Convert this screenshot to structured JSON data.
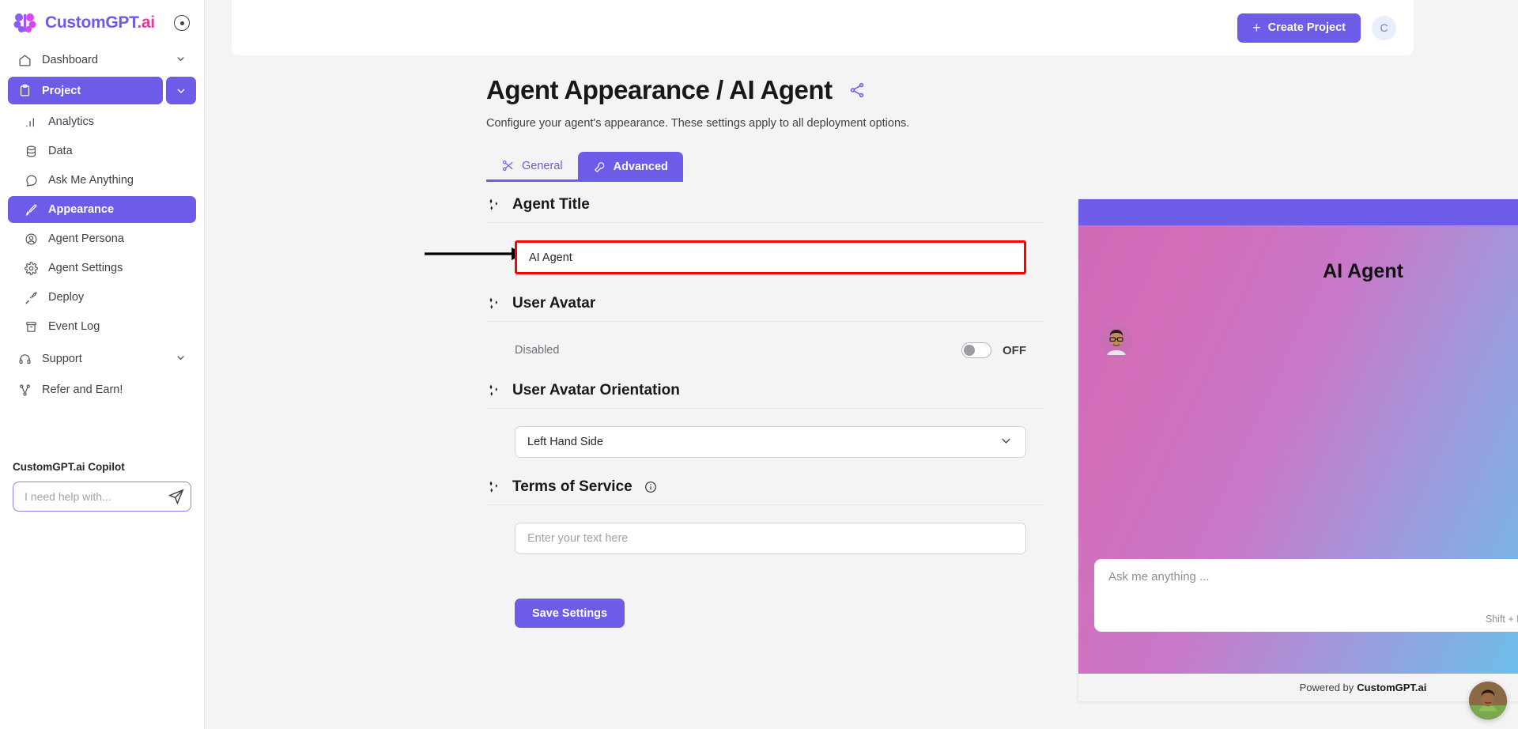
{
  "brand": {
    "name_part1": "CustomGPT",
    "name_part2": ".ai"
  },
  "sidebar": {
    "dashboard": {
      "label": "Dashboard",
      "icon": "home-icon"
    },
    "project": {
      "label": "Project",
      "icon": "clipboard-icon"
    },
    "sub_items": [
      {
        "label": "Analytics",
        "icon": "bar-chart-icon"
      },
      {
        "label": "Data",
        "icon": "database-icon"
      },
      {
        "label": "Ask Me Anything",
        "icon": "chat-bubble-icon"
      },
      {
        "label": "Appearance",
        "icon": "brush-icon"
      },
      {
        "label": "Agent Persona",
        "icon": "user-circle-icon"
      },
      {
        "label": "Agent Settings",
        "icon": "gear-icon"
      },
      {
        "label": "Deploy",
        "icon": "rocket-icon"
      },
      {
        "label": "Event Log",
        "icon": "archive-icon"
      }
    ],
    "support": {
      "label": "Support",
      "icon": "headset-icon"
    },
    "refer": {
      "label": "Refer and Earn!",
      "icon": "share-nodes-icon"
    },
    "copilot": {
      "title": "CustomGPT.ai Copilot",
      "placeholder": "I need help with...",
      "value": ""
    }
  },
  "topbar": {
    "create_project_label": "Create Project",
    "plus": "+",
    "avatar_initial": "C"
  },
  "page": {
    "title": "Agent Appearance / AI Agent",
    "subtitle": "Configure your agent's appearance. These settings apply to all deployment options.",
    "tabs": [
      {
        "label": "General",
        "icon": "scissors-icon",
        "active": false
      },
      {
        "label": "Advanced",
        "icon": "wrench-icon",
        "active": true
      }
    ]
  },
  "form": {
    "agent_title": {
      "label": "Agent Title",
      "value": "AI Agent",
      "highlight_color": "#ff0000"
    },
    "user_avatar": {
      "label": "User Avatar",
      "state_label": "Disabled",
      "toggle_label": "OFF",
      "toggle_on": false
    },
    "user_avatar_orientation": {
      "label": "User Avatar Orientation",
      "selected": "Left Hand Side"
    },
    "terms_of_service": {
      "label": "Terms of Service",
      "placeholder": "Enter your text here",
      "value": ""
    },
    "save_label": "Save Settings"
  },
  "chat_preview": {
    "agent_title": "AI Agent",
    "input_placeholder": "Ask me anything ...",
    "hint": "Shift + Enter to add a new line",
    "footer_prefix": "Powered by ",
    "footer_brand": "CustomGPT.ai",
    "header_icons": [
      "refresh-icon",
      "close-icon"
    ]
  },
  "colors": {
    "accent": "#6c5ce7",
    "brand_pink": "#e0409a",
    "highlight": "#ff0000"
  }
}
